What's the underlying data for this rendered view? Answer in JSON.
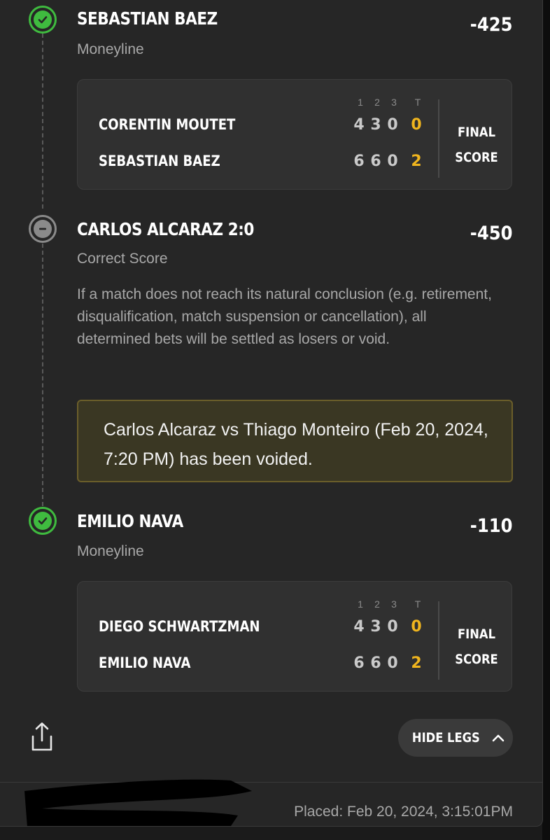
{
  "legs": [
    {
      "selection": "SEBASTIAN BAEZ",
      "market": "Moneyline",
      "odds": "-425",
      "status": "won",
      "status_icon": "check-circle-icon",
      "score": {
        "period_headers": [
          "1",
          "2",
          "3",
          "T"
        ],
        "teams": [
          {
            "name": "CORENTIN MOUTET",
            "periods": [
              "4",
              "3",
              "0"
            ],
            "total": "0"
          },
          {
            "name": "SEBASTIAN BAEZ",
            "periods": [
              "6",
              "6",
              "0"
            ],
            "total": "2"
          }
        ],
        "final_line1": "FINAL",
        "final_line2": "SCORE"
      }
    },
    {
      "selection": "CARLOS ALCARAZ 2:0",
      "market": "Correct Score",
      "odds": "-450",
      "status": "void",
      "status_icon": "minus-circle-icon",
      "rules_text": "If a match does not reach its natural conclusion (e.g. retirement, disqualification, match suspension or cancellation), all determined bets will be settled as losers or void.",
      "void_notice": "Carlos Alcaraz vs Thiago Monteiro (Feb 20, 2024, 7:20 PM) has been voided."
    },
    {
      "selection": "EMILIO NAVA",
      "market": "Moneyline",
      "odds": "-110",
      "status": "won",
      "status_icon": "check-circle-icon",
      "score": {
        "period_headers": [
          "1",
          "2",
          "3",
          "T"
        ],
        "teams": [
          {
            "name": "DIEGO SCHWARTZMAN",
            "periods": [
              "4",
              "3",
              "0"
            ],
            "total": "0"
          },
          {
            "name": "EMILIO NAVA",
            "periods": [
              "6",
              "6",
              "0"
            ],
            "total": "2"
          }
        ],
        "final_line1": "FINAL",
        "final_line2": "SCORE"
      }
    }
  ],
  "actions": {
    "hide_legs_label": "HIDE LEGS",
    "share_icon": "share-icon",
    "hide_legs_icon": "chevron-up-icon"
  },
  "footer": {
    "placed": "Placed: Feb 20, 2024, 3:15:01PM"
  },
  "colors": {
    "won": "#3fbb3f",
    "void": "#8a8a8a",
    "total_score": "#f0b51e",
    "void_notice_bg": "#3a3723",
    "void_notice_border": "#6b5e2a"
  }
}
